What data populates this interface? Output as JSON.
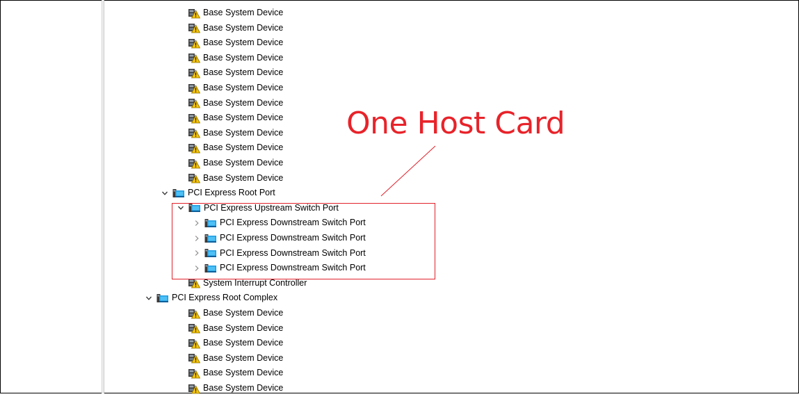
{
  "tree": {
    "rows": [
      {
        "label": "Base System Device",
        "icon": "warning-device-icon",
        "expander": "none"
      },
      {
        "label": "Base System Device",
        "icon": "warning-device-icon",
        "expander": "none"
      },
      {
        "label": "Base System Device",
        "icon": "warning-device-icon",
        "expander": "none"
      },
      {
        "label": "Base System Device",
        "icon": "warning-device-icon",
        "expander": "none"
      },
      {
        "label": "Base System Device",
        "icon": "warning-device-icon",
        "expander": "none"
      },
      {
        "label": "Base System Device",
        "icon": "warning-device-icon",
        "expander": "none"
      },
      {
        "label": "Base System Device",
        "icon": "warning-device-icon",
        "expander": "none"
      },
      {
        "label": "Base System Device",
        "icon": "warning-device-icon",
        "expander": "none"
      },
      {
        "label": "Base System Device",
        "icon": "warning-device-icon",
        "expander": "none"
      },
      {
        "label": "Base System Device",
        "icon": "warning-device-icon",
        "expander": "none"
      },
      {
        "label": "Base System Device",
        "icon": "warning-device-icon",
        "expander": "none"
      },
      {
        "label": "Base System Device",
        "icon": "warning-device-icon",
        "expander": "none"
      },
      {
        "label": "PCI Express Root Port",
        "icon": "pci-port-icon",
        "expander": "expanded"
      },
      {
        "label": "PCI Express Upstream Switch Port",
        "icon": "pci-port-icon",
        "expander": "expanded"
      },
      {
        "label": "PCI Express Downstream Switch Port",
        "icon": "pci-port-icon",
        "expander": "collapsed"
      },
      {
        "label": "PCI Express Downstream Switch Port",
        "icon": "pci-port-icon",
        "expander": "collapsed"
      },
      {
        "label": "PCI Express Downstream Switch Port",
        "icon": "pci-port-icon",
        "expander": "collapsed"
      },
      {
        "label": "PCI Express Downstream Switch Port",
        "icon": "pci-port-icon",
        "expander": "collapsed"
      },
      {
        "label": "System Interrupt Controller",
        "icon": "warning-device-icon",
        "expander": "none"
      },
      {
        "label": "PCI Express Root Complex",
        "icon": "pci-port-icon",
        "expander": "expanded"
      },
      {
        "label": "Base System Device",
        "icon": "warning-device-icon",
        "expander": "none"
      },
      {
        "label": "Base System Device",
        "icon": "warning-device-icon",
        "expander": "none"
      },
      {
        "label": "Base System Device",
        "icon": "warning-device-icon",
        "expander": "none"
      },
      {
        "label": "Base System Device",
        "icon": "warning-device-icon",
        "expander": "none"
      },
      {
        "label": "Base System Device",
        "icon": "warning-device-icon",
        "expander": "none"
      },
      {
        "label": "Base System Device",
        "icon": "warning-device-icon",
        "expander": "none"
      }
    ]
  },
  "annotation": {
    "text": "One Host Card",
    "color": "#e8232a"
  },
  "colors": {
    "pci_icon_blue": "#1e9be0",
    "warning_yellow": "#f5c400"
  }
}
